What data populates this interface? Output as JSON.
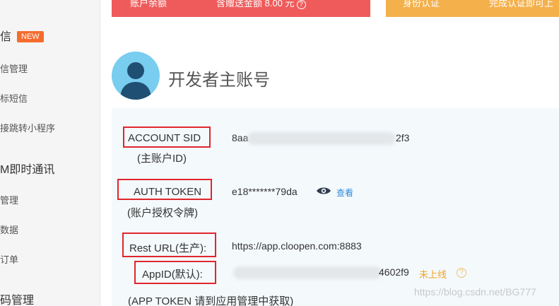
{
  "sidebar": {
    "section1_title": "信",
    "section1_badge": "NEW",
    "section1_items": [
      "信管理",
      "标短信",
      "接跳转小程序"
    ],
    "section2_title": "M即时通讯",
    "section2_items": [
      "管理",
      "数据",
      "订单"
    ],
    "section3_title": "码管理"
  },
  "banners": {
    "red_left": "账户余额",
    "red_right": "含赠送金额 8.00 元",
    "red_help": "?",
    "orange_left": "身份认证",
    "orange_right": "完成认证即可上"
  },
  "header": {
    "title": "开发者主账号"
  },
  "fields": {
    "account_sid_label": "ACCOUNT SID",
    "account_sid_sub": "(主账户ID)",
    "account_sid_prefix": "8aa",
    "account_sid_suffix": "2f3",
    "auth_token_label": "AUTH TOKEN",
    "auth_token_sub": "(账户授权令牌)",
    "auth_token_value": "e18*******79da",
    "auth_token_view": "查看",
    "rest_url_label": "Rest URL(生产):",
    "rest_url_value": "https://app.cloopen.com:8883",
    "appid_label": "AppID(默认):",
    "appid_suffix": "4602f9",
    "appid_status": "未上线",
    "appid_help": "?",
    "app_token_note": "(APP TOKEN 请到应用管理中获取)"
  },
  "watermark": "https://blog.csdn.net/BG777",
  "colors": {
    "highlight_box": "#e0262c",
    "link": "#2e8bd9",
    "status": "#f0a52b",
    "banner_red": "#ef5b5b",
    "banner_orange": "#f4b04b"
  }
}
